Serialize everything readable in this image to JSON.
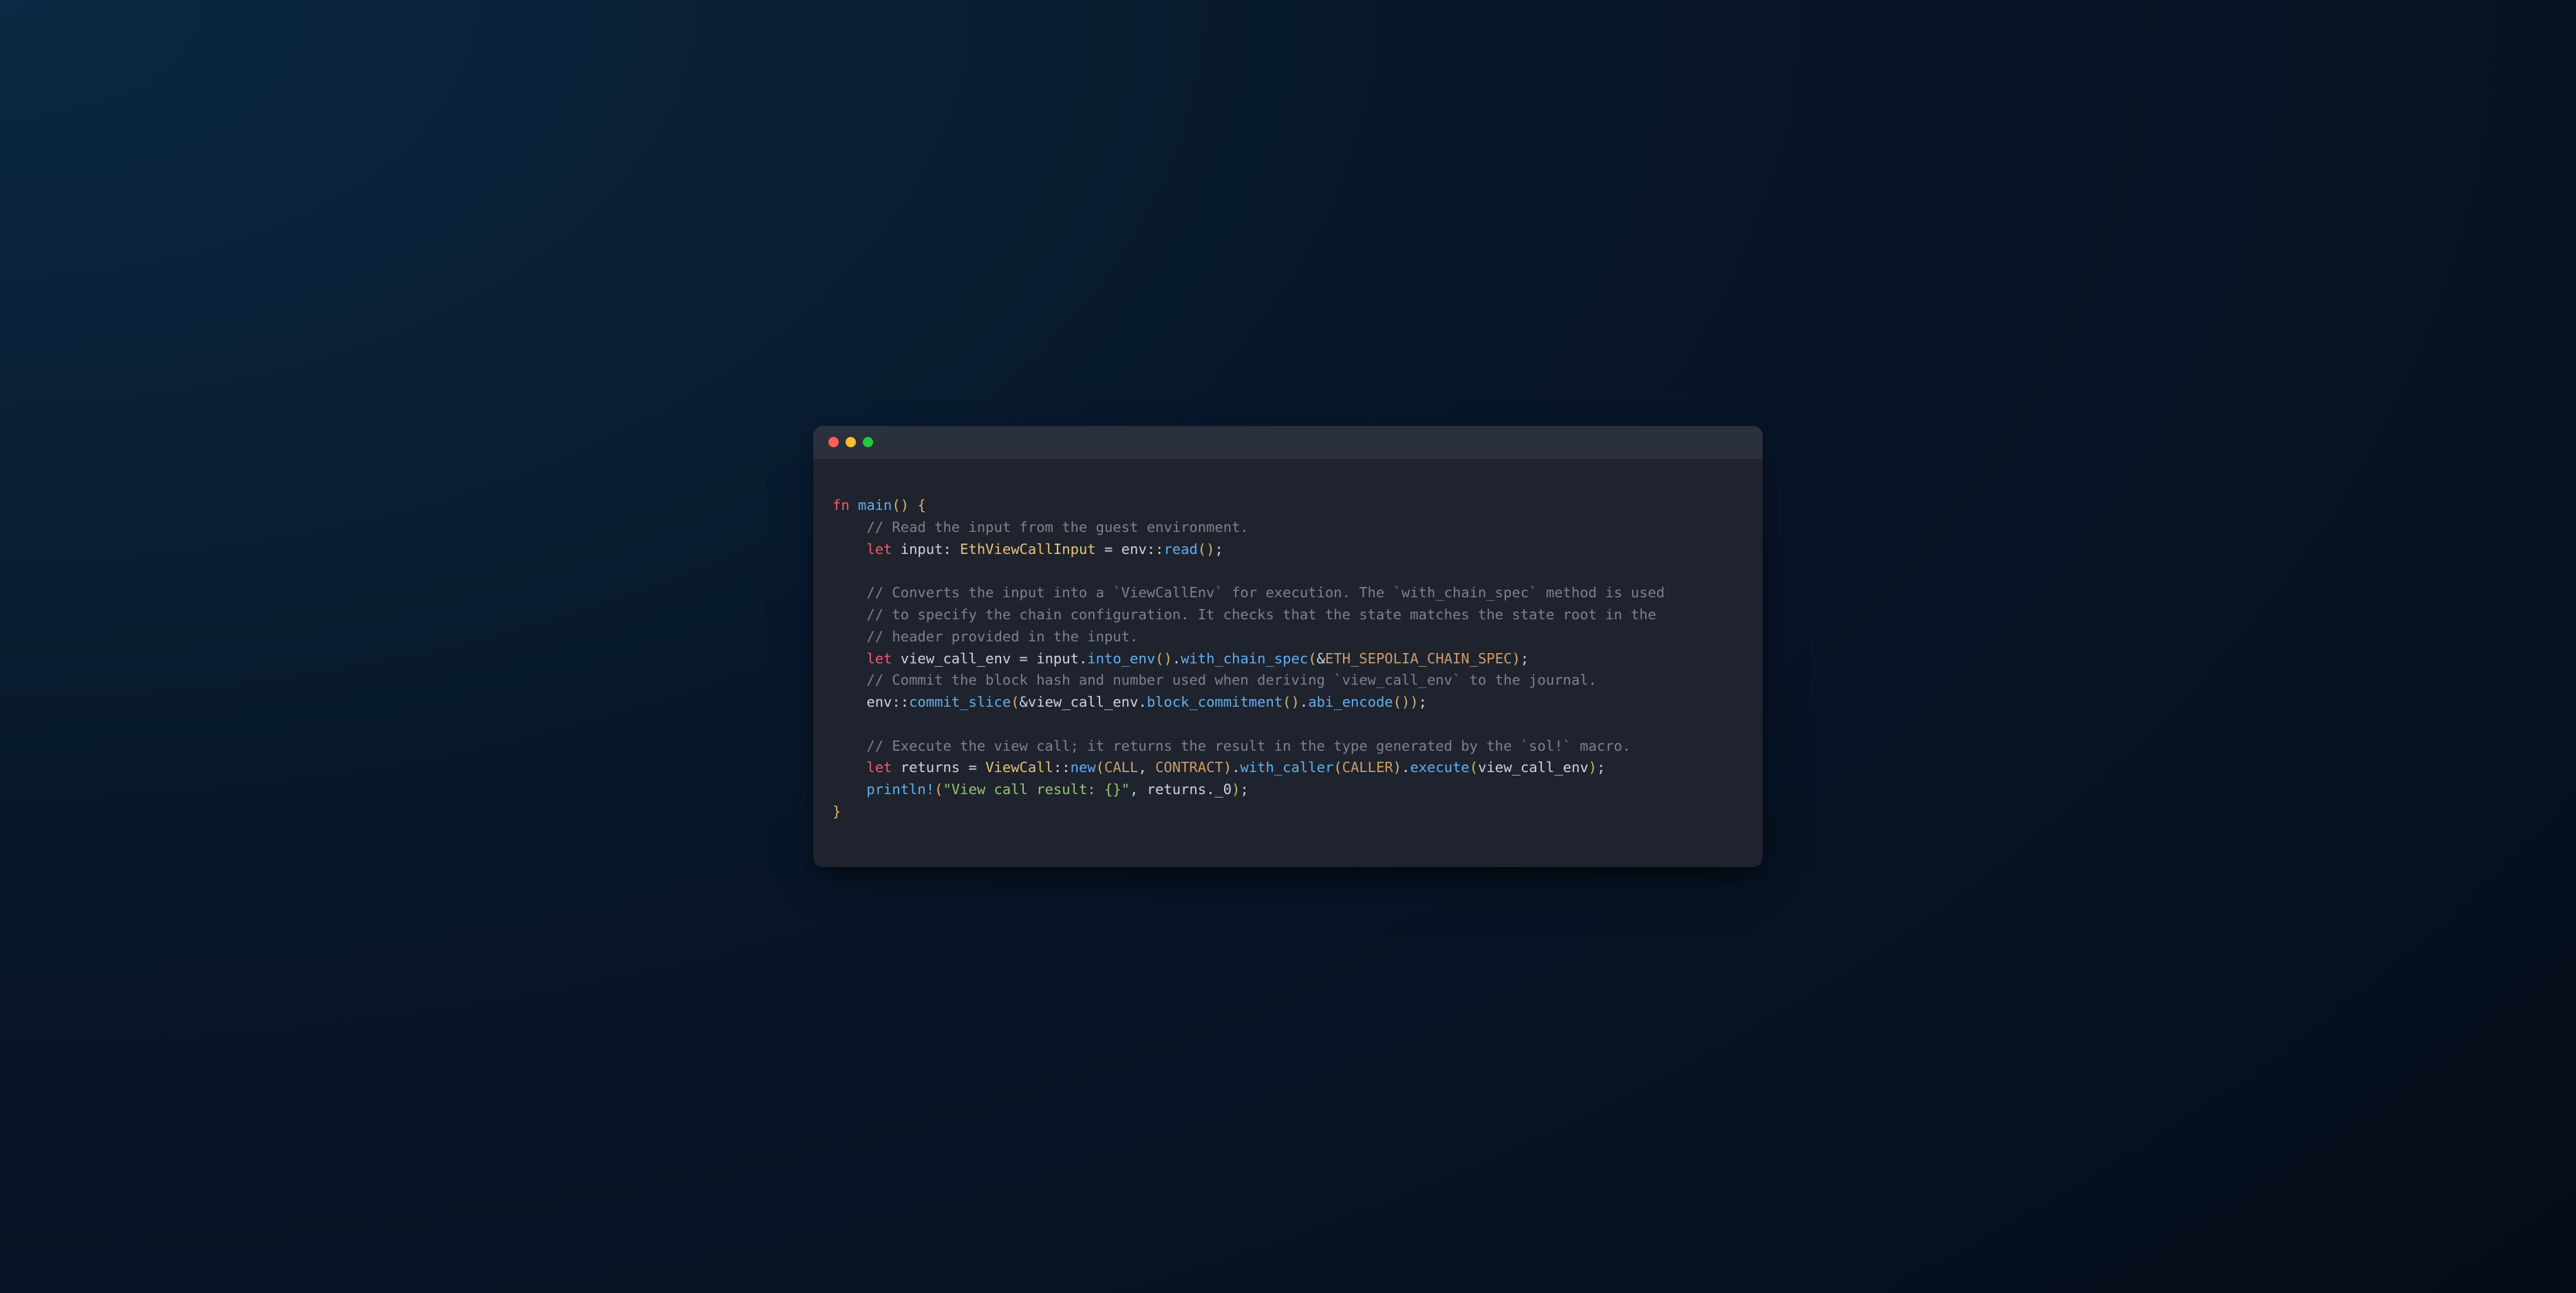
{
  "traffic_lights": [
    "red",
    "yellow",
    "green"
  ],
  "colors": {
    "bg_start": "#0b2942",
    "bg_end": "#060d1a",
    "window": "#1e232d",
    "titlebar": "#2a303c",
    "red": "#ff5f56",
    "yellow": "#ffbd2e",
    "green": "#27c93f",
    "keyword": "#ef596f",
    "function": "#61afef",
    "type": "#e5c07b",
    "comment": "#7b828f",
    "constant": "#d19a66",
    "string": "#98c379",
    "text": "#cdd3df"
  },
  "code": {
    "lang": "rust",
    "tokens": [
      [
        {
          "c": "kw",
          "t": "fn"
        },
        {
          "c": "op",
          "t": " "
        },
        {
          "c": "fnname",
          "t": "main"
        },
        {
          "c": "p",
          "t": "()"
        },
        {
          "c": "op",
          "t": " "
        },
        {
          "c": "p",
          "t": "{"
        }
      ],
      [
        {
          "c": "op",
          "t": "    "
        },
        {
          "c": "cmt",
          "t": "// Read the input from the guest environment."
        }
      ],
      [
        {
          "c": "op",
          "t": "    "
        },
        {
          "c": "kw",
          "t": "let"
        },
        {
          "c": "op",
          "t": " "
        },
        {
          "c": "id",
          "t": "input"
        },
        {
          "c": "op",
          "t": ": "
        },
        {
          "c": "ty",
          "t": "EthViewCallInput"
        },
        {
          "c": "op",
          "t": " = "
        },
        {
          "c": "id",
          "t": "env"
        },
        {
          "c": "op",
          "t": "::"
        },
        {
          "c": "fnname",
          "t": "read"
        },
        {
          "c": "p",
          "t": "()"
        },
        {
          "c": "op",
          "t": ";"
        }
      ],
      [
        {
          "c": "op",
          "t": ""
        }
      ],
      [
        {
          "c": "op",
          "t": "    "
        },
        {
          "c": "cmt",
          "t": "// Converts the input into a `ViewCallEnv` for execution. The `with_chain_spec` method is used"
        }
      ],
      [
        {
          "c": "op",
          "t": "    "
        },
        {
          "c": "cmt",
          "t": "// to specify the chain configuration. It checks that the state matches the state root in the"
        }
      ],
      [
        {
          "c": "op",
          "t": "    "
        },
        {
          "c": "cmt",
          "t": "// header provided in the input."
        }
      ],
      [
        {
          "c": "op",
          "t": "    "
        },
        {
          "c": "kw",
          "t": "let"
        },
        {
          "c": "op",
          "t": " "
        },
        {
          "c": "id",
          "t": "view_call_env"
        },
        {
          "c": "op",
          "t": " = "
        },
        {
          "c": "id",
          "t": "input"
        },
        {
          "c": "op",
          "t": "."
        },
        {
          "c": "fnname",
          "t": "into_env"
        },
        {
          "c": "p",
          "t": "()"
        },
        {
          "c": "op",
          "t": "."
        },
        {
          "c": "fnname",
          "t": "with_chain_spec"
        },
        {
          "c": "p",
          "t": "("
        },
        {
          "c": "amp",
          "t": "&"
        },
        {
          "c": "cst",
          "t": "ETH_SEPOLIA_CHAIN_SPEC"
        },
        {
          "c": "p",
          "t": ")"
        },
        {
          "c": "op",
          "t": ";"
        }
      ],
      [
        {
          "c": "op",
          "t": "    "
        },
        {
          "c": "cmt",
          "t": "// Commit the block hash and number used when deriving `view_call_env` to the journal."
        }
      ],
      [
        {
          "c": "op",
          "t": "    "
        },
        {
          "c": "id",
          "t": "env"
        },
        {
          "c": "op",
          "t": "::"
        },
        {
          "c": "fnname",
          "t": "commit_slice"
        },
        {
          "c": "p",
          "t": "("
        },
        {
          "c": "amp",
          "t": "&"
        },
        {
          "c": "id",
          "t": "view_call_env"
        },
        {
          "c": "op",
          "t": "."
        },
        {
          "c": "fnname",
          "t": "block_commitment"
        },
        {
          "c": "p",
          "t": "()"
        },
        {
          "c": "op",
          "t": "."
        },
        {
          "c": "fnname",
          "t": "abi_encode"
        },
        {
          "c": "p",
          "t": "())"
        },
        {
          "c": "op",
          "t": ";"
        }
      ],
      [
        {
          "c": "op",
          "t": ""
        }
      ],
      [
        {
          "c": "op",
          "t": "    "
        },
        {
          "c": "cmt",
          "t": "// Execute the view call; it returns the result in the type generated by the `sol!` macro."
        }
      ],
      [
        {
          "c": "op",
          "t": "    "
        },
        {
          "c": "kw",
          "t": "let"
        },
        {
          "c": "op",
          "t": " "
        },
        {
          "c": "id",
          "t": "returns"
        },
        {
          "c": "op",
          "t": " = "
        },
        {
          "c": "ty",
          "t": "ViewCall"
        },
        {
          "c": "op",
          "t": "::"
        },
        {
          "c": "fnname",
          "t": "new"
        },
        {
          "c": "p",
          "t": "("
        },
        {
          "c": "cst",
          "t": "CALL"
        },
        {
          "c": "op",
          "t": ", "
        },
        {
          "c": "cst",
          "t": "CONTRACT"
        },
        {
          "c": "p",
          "t": ")"
        },
        {
          "c": "op",
          "t": "."
        },
        {
          "c": "fnname",
          "t": "with_caller"
        },
        {
          "c": "p",
          "t": "("
        },
        {
          "c": "cst",
          "t": "CALLER"
        },
        {
          "c": "p",
          "t": ")"
        },
        {
          "c": "op",
          "t": "."
        },
        {
          "c": "fnname",
          "t": "execute"
        },
        {
          "c": "p",
          "t": "("
        },
        {
          "c": "id",
          "t": "view_call_env"
        },
        {
          "c": "p",
          "t": ")"
        },
        {
          "c": "op",
          "t": ";"
        }
      ],
      [
        {
          "c": "op",
          "t": "    "
        },
        {
          "c": "mac",
          "t": "println!"
        },
        {
          "c": "p",
          "t": "("
        },
        {
          "c": "str",
          "t": "\"View call result: {}\""
        },
        {
          "c": "op",
          "t": ", "
        },
        {
          "c": "id",
          "t": "returns"
        },
        {
          "c": "op",
          "t": "."
        },
        {
          "c": "id",
          "t": "_0"
        },
        {
          "c": "p",
          "t": ")"
        },
        {
          "c": "op",
          "t": ";"
        }
      ],
      [
        {
          "c": "p",
          "t": "}"
        }
      ]
    ]
  }
}
